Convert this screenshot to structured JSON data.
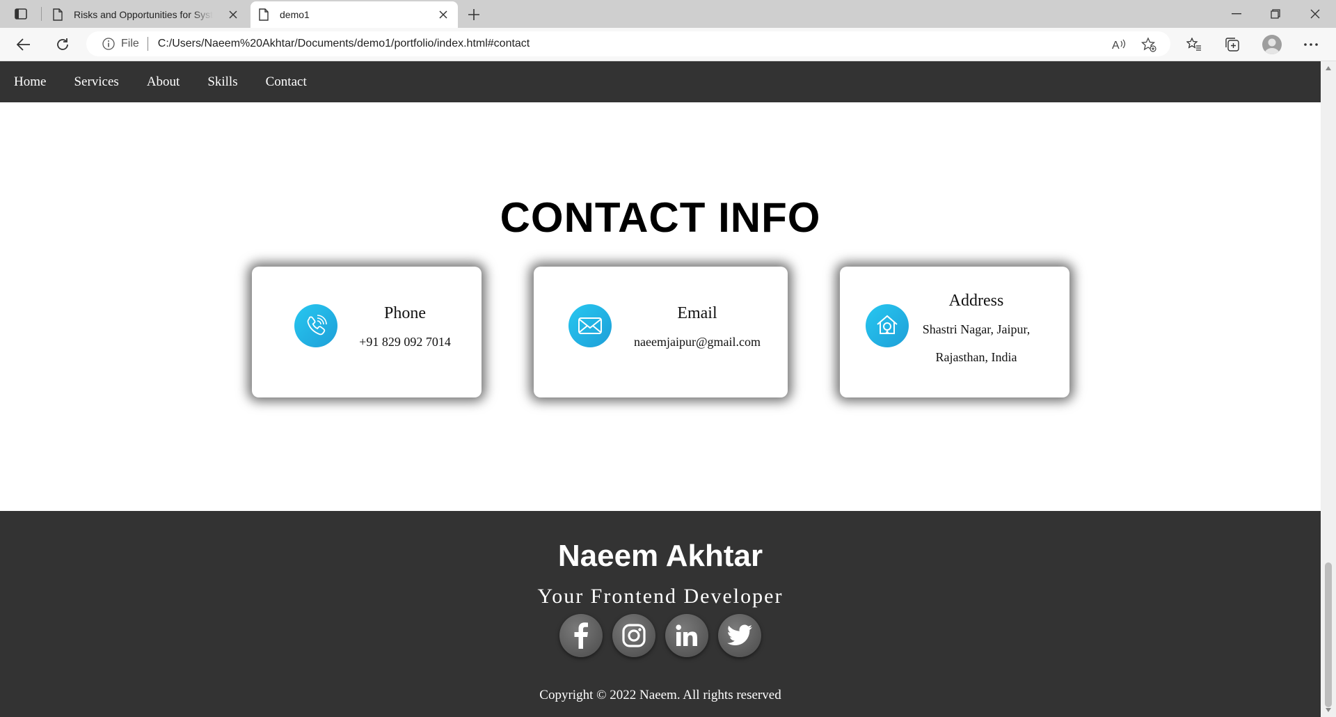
{
  "browser": {
    "tabs": [
      {
        "title": "Risks and Opportunities for Systems"
      },
      {
        "title": "demo1"
      }
    ],
    "address": {
      "scheme_label": "File",
      "url": "C:/Users/Naeem%20Akhtar/Documents/demo1/portfolio/index.html#contact"
    }
  },
  "nav": {
    "items": [
      "Home",
      "Services",
      "About",
      "Skills",
      "Contact"
    ]
  },
  "contact": {
    "heading": "CONTACT INFO",
    "cards": [
      {
        "title": "Phone",
        "value": "+91 829 092 7014",
        "icon": "phone-icon"
      },
      {
        "title": "Email",
        "value": "naeemjaipur@gmail.com",
        "icon": "mail-icon"
      },
      {
        "title": "Address",
        "line1": "Shastri Nagar, Jaipur,",
        "line2": "Rajasthan, India",
        "icon": "home-location-icon"
      }
    ],
    "accent_color": "#1fb6ea"
  },
  "footer": {
    "name": "Naeem Akhtar",
    "tagline": "Your Frontend Developer",
    "socials": [
      "facebook-icon",
      "instagram-icon",
      "linkedin-icon",
      "twitter-icon"
    ],
    "copyright": "Copyright © 2022 Naeem. All rights reserved",
    "background": "#333333"
  }
}
